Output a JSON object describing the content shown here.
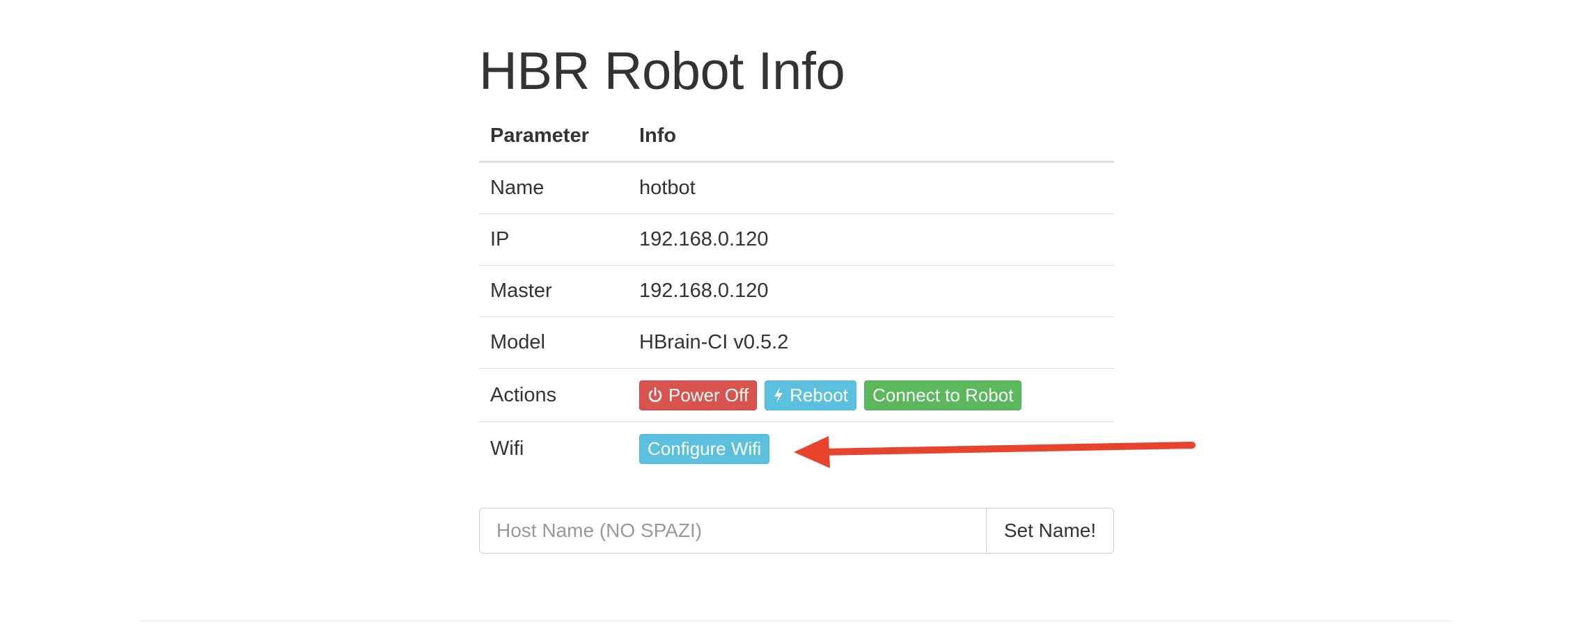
{
  "page": {
    "title": "HBR Robot Info"
  },
  "table": {
    "headers": [
      "Parameter",
      "Info"
    ],
    "rows": [
      {
        "param": "Name",
        "value": "hotbot"
      },
      {
        "param": "IP",
        "value": "192.168.0.120"
      },
      {
        "param": "Master",
        "value": "192.168.0.120"
      },
      {
        "param": "Model",
        "value": "HBrain-CI v0.5.2"
      },
      {
        "param": "Actions"
      },
      {
        "param": "Wifi"
      }
    ]
  },
  "actions": {
    "power_off": {
      "label": "Power Off",
      "icon": "power-icon",
      "color": "#d9534f"
    },
    "reboot": {
      "label": "Reboot",
      "icon": "bolt-icon",
      "color": "#5bc0de"
    },
    "connect": {
      "label": "Connect to Robot",
      "color": "#5cb85c"
    }
  },
  "wifi": {
    "configure_label": "Configure Wifi",
    "color": "#5bc0de"
  },
  "hostname_form": {
    "placeholder": "Host Name (NO SPAZI)",
    "value": "",
    "submit_label": "Set Name!"
  },
  "annotation": {
    "arrow_color": "#e8432d",
    "points_to": "configure-wifi-button"
  }
}
